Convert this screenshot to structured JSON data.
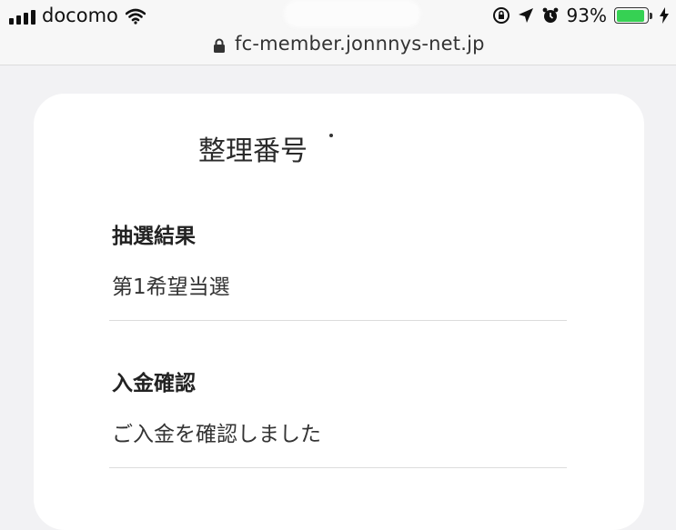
{
  "status_bar": {
    "carrier": "docomo",
    "battery_percent": "93%",
    "battery_level": 0.93,
    "icons": [
      "signal-icon",
      "wifi-icon",
      "orientation-lock-icon",
      "location-icon",
      "alarm-icon",
      "battery-icon",
      "charging-icon"
    ]
  },
  "browser": {
    "url": "fc-member.jonnnys-net.jp"
  },
  "card": {
    "ticket_label": "整理番号",
    "sections": [
      {
        "label": "抽選結果",
        "value": "第1希望当選"
      },
      {
        "label": "入金確認",
        "value": "ご入金を確認しました"
      }
    ]
  },
  "colors": {
    "battery_green": "#36d153",
    "page_background": "#f2f2f4",
    "card_background": "#ffffff"
  }
}
